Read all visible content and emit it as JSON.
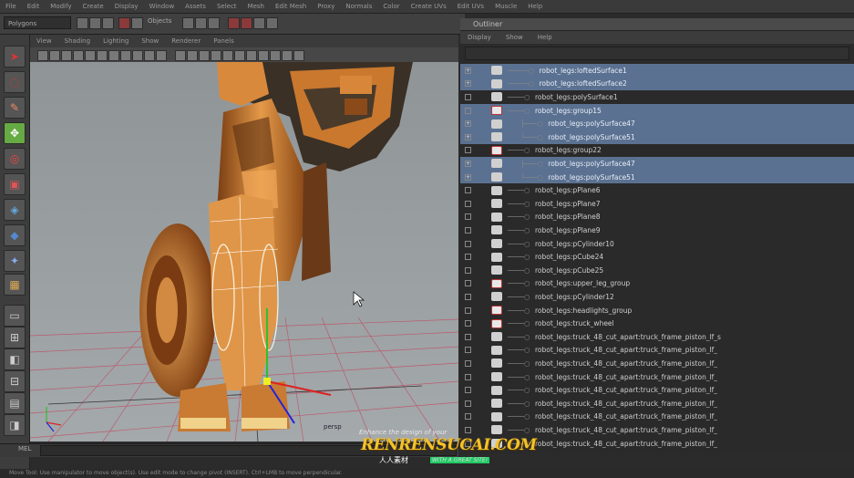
{
  "menubar": {
    "items": [
      "File",
      "Edit",
      "Modify",
      "Create",
      "Display",
      "Window",
      "Assets",
      "Select",
      "Mesh",
      "Edit Mesh",
      "Proxy",
      "Normals",
      "Color",
      "Create UVs",
      "Edit UVs",
      "Muscle",
      "Help"
    ]
  },
  "statusline": {
    "mode": "Polygons",
    "objects_label": "Objects"
  },
  "viewport": {
    "menu": [
      "View",
      "Shading",
      "Lighting",
      "Show",
      "Renderer",
      "Panels"
    ],
    "camera_label": "persp"
  },
  "outliner": {
    "title": "Outliner",
    "menu": [
      "Display",
      "Show",
      "Help"
    ],
    "rows": [
      {
        "label": "robot_legs:loftedSurface1",
        "tree": "─────○ ",
        "icon": "mesh",
        "expand": "+",
        "selected": true
      },
      {
        "label": "robot_legs:loftedSurface2",
        "tree": "─────○ ",
        "icon": "mesh",
        "expand": "+",
        "selected": true
      },
      {
        "label": "robot_legs:polySurface1",
        "tree": "────○ ",
        "icon": "mesh",
        "expand": "",
        "selected": false
      },
      {
        "label": "robot_legs:group15",
        "tree": "────○ ",
        "icon": "group",
        "expand": "",
        "selected": true
      },
      {
        "label": "robot_legs:polySurface47",
        "tree": "      ├───○ ",
        "icon": "mesh",
        "expand": "+",
        "selected": true
      },
      {
        "label": "robot_legs:polySurface51",
        "tree": "      └───○ ",
        "icon": "mesh",
        "expand": "+",
        "selected": true
      },
      {
        "label": "robot_legs:group22",
        "tree": "────○ ",
        "icon": "group",
        "expand": "",
        "selected": false
      },
      {
        "label": "robot_legs:polySurface47",
        "tree": "      ├───○ ",
        "icon": "mesh",
        "expand": "+",
        "selected": true
      },
      {
        "label": "robot_legs:polySurface51",
        "tree": "      └───○ ",
        "icon": "mesh",
        "expand": "+",
        "selected": true
      },
      {
        "label": "robot_legs:pPlane6",
        "tree": "────○ ",
        "icon": "mesh",
        "expand": "",
        "selected": false
      },
      {
        "label": "robot_legs:pPlane7",
        "tree": "────○ ",
        "icon": "mesh",
        "expand": "",
        "selected": false
      },
      {
        "label": "robot_legs:pPlane8",
        "tree": "────○ ",
        "icon": "mesh",
        "expand": "",
        "selected": false
      },
      {
        "label": "robot_legs:pPlane9",
        "tree": "────○ ",
        "icon": "mesh",
        "expand": "",
        "selected": false
      },
      {
        "label": "robot_legs:pCylinder10",
        "tree": "────○ ",
        "icon": "mesh",
        "expand": "",
        "selected": false
      },
      {
        "label": "robot_legs:pCube24",
        "tree": "────○ ",
        "icon": "mesh",
        "expand": "",
        "selected": false
      },
      {
        "label": "robot_legs:pCube25",
        "tree": "────○ ",
        "icon": "mesh",
        "expand": "",
        "selected": false
      },
      {
        "label": "robot_legs:upper_leg_group",
        "tree": "────○ ",
        "icon": "group",
        "expand": "",
        "selected": false
      },
      {
        "label": "robot_legs:pCylinder12",
        "tree": "────○ ",
        "icon": "mesh",
        "expand": "",
        "selected": false
      },
      {
        "label": "robot_legs:headlights_group",
        "tree": "────○ ",
        "icon": "group",
        "expand": "",
        "selected": false
      },
      {
        "label": "robot_legs:truck_wheel",
        "tree": "────○ ",
        "icon": "group",
        "expand": "",
        "selected": false
      },
      {
        "label": "robot_legs:truck_48_cut_apart:truck_frame_piston_lf_s",
        "tree": "────○ ",
        "icon": "mesh",
        "expand": "",
        "selected": false
      },
      {
        "label": "robot_legs:truck_48_cut_apart:truck_frame_piston_lf_",
        "tree": "────○ ",
        "icon": "mesh",
        "expand": "",
        "selected": false
      },
      {
        "label": "robot_legs:truck_48_cut_apart:truck_frame_piston_lf_",
        "tree": "────○ ",
        "icon": "mesh",
        "expand": "",
        "selected": false
      },
      {
        "label": "robot_legs:truck_48_cut_apart:truck_frame_piston_lf_",
        "tree": "────○ ",
        "icon": "mesh",
        "expand": "",
        "selected": false
      },
      {
        "label": "robot_legs:truck_48_cut_apart:truck_frame_piston_lf_",
        "tree": "────○ ",
        "icon": "mesh",
        "expand": "",
        "selected": false
      },
      {
        "label": "robot_legs:truck_48_cut_apart:truck_frame_piston_lf_",
        "tree": "────○ ",
        "icon": "mesh",
        "expand": "",
        "selected": false
      },
      {
        "label": "robot_legs:truck_48_cut_apart:truck_frame_piston_lf_",
        "tree": "────○ ",
        "icon": "mesh",
        "expand": "",
        "selected": false
      },
      {
        "label": "robot_legs:truck_48_cut_apart:truck_frame_piston_lf_",
        "tree": "────○ ",
        "icon": "mesh",
        "expand": "",
        "selected": false
      },
      {
        "label": "robot_legs:truck_48_cut_apart:truck_frame_piston_lf_",
        "tree": "────○ ",
        "icon": "mesh",
        "expand": "",
        "selected": false
      }
    ]
  },
  "commandline": {
    "label": "MEL"
  },
  "helpline": {
    "text": "Move Tool: Use manipulator to move object(s). Use edit mode to change pivot (INSERT). Ctrl+LMB to move perpendicular."
  },
  "watermark": {
    "top": "Enhance the design of your",
    "main": "RENRENSUCAI.COM",
    "sub": "人人素材",
    "tag": "WITH A GREAT SITE!"
  },
  "colors": {
    "selection": "#5b7191",
    "viewport_bg": "#9aa0a2",
    "grid_line": "#c44a63",
    "robot_orange": "#d88a3a"
  }
}
